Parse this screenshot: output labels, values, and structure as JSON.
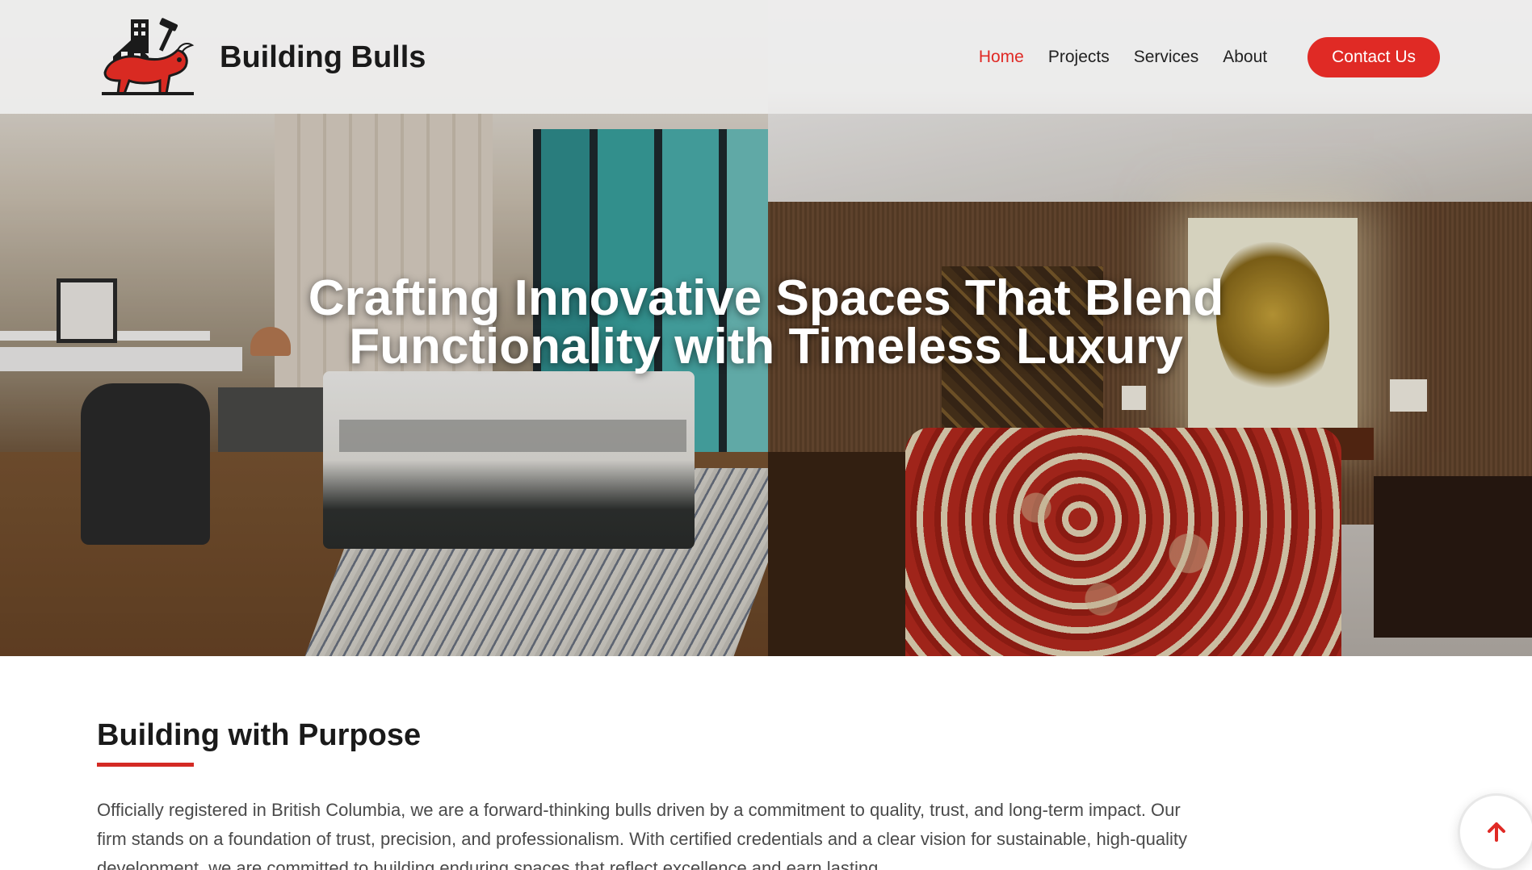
{
  "brand": {
    "name": "Building Bulls"
  },
  "nav": {
    "items": [
      {
        "label": "Home",
        "active": true
      },
      {
        "label": "Projects",
        "active": false
      },
      {
        "label": "Services",
        "active": false
      },
      {
        "label": "About",
        "active": false
      }
    ],
    "contact_label": "Contact Us"
  },
  "hero": {
    "title_line1": "Crafting Innovative Spaces That Blend",
    "title_line2": "Functionality with Timeless Luxury"
  },
  "about": {
    "title": "Building with Purpose",
    "text": "Officially registered in British Columbia, we are a forward-thinking bulls driven by a commitment to quality, trust, and long-term impact. Our firm stands on a foundation of trust, precision, and professionalism. With certified credentials and a clear vision for sustainable, high-quality development, we are committed to building enduring spaces that reflect excellence and earn lasting"
  },
  "icons": {
    "logo": "bull-house-logo",
    "scroll_top": "arrow-up-icon"
  },
  "colors": {
    "accent": "#e02a25",
    "text": "#1a1a1a",
    "body_text": "#4a4a4a"
  }
}
